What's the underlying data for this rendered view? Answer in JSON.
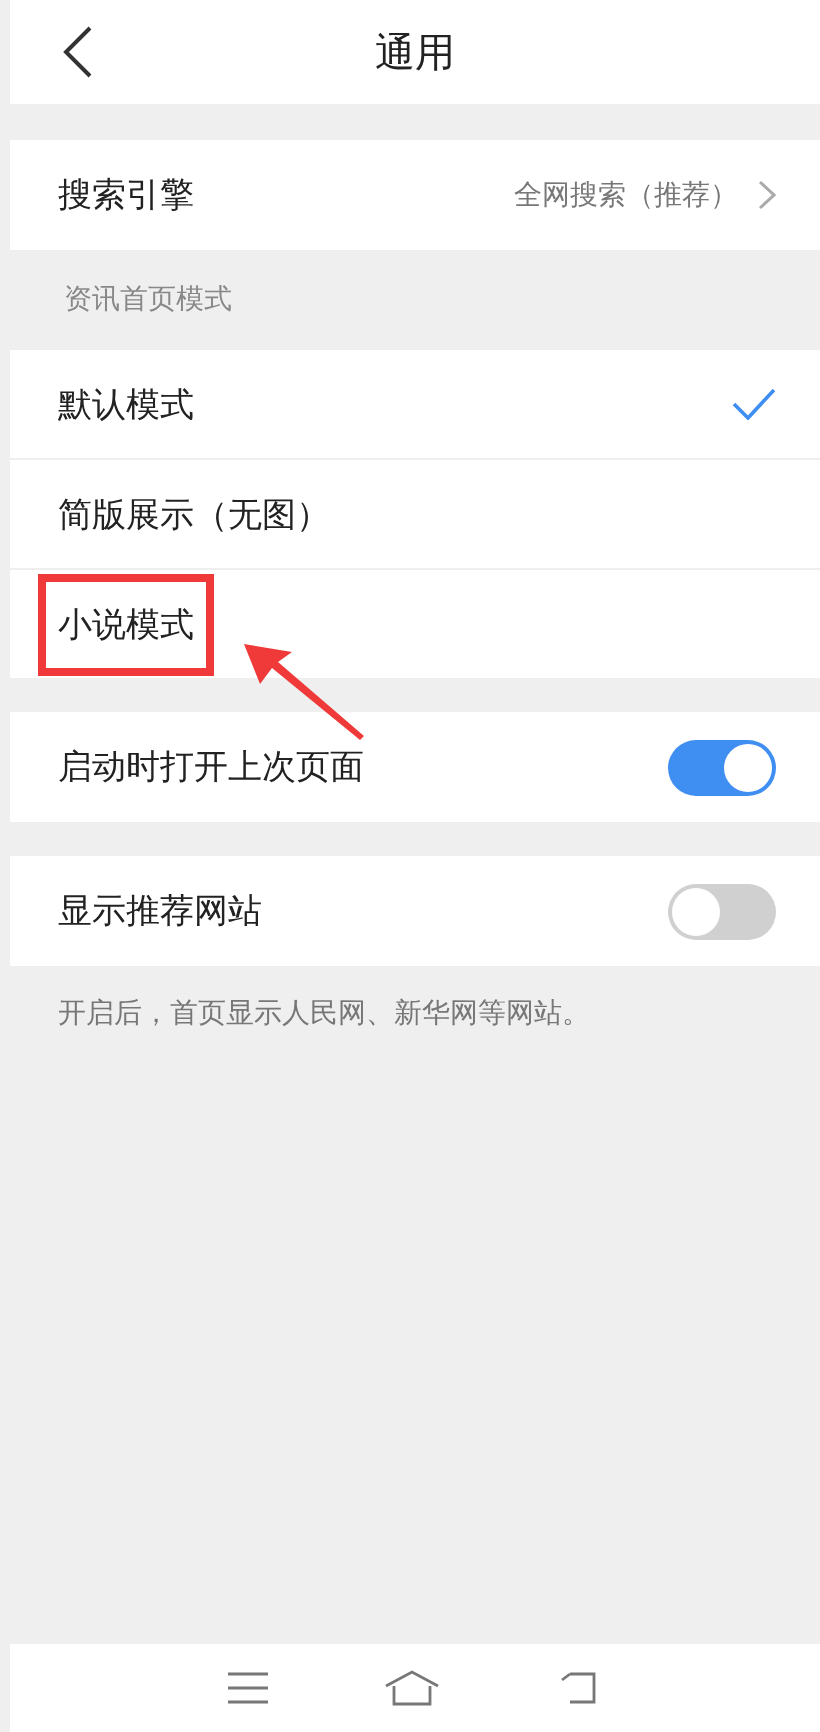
{
  "header": {
    "title": "通用"
  },
  "search_engine": {
    "label": "搜索引擎",
    "value": "全网搜索（推荐）"
  },
  "news_home_mode": {
    "heading": "资讯首页模式",
    "options": [
      {
        "label": "默认模式",
        "selected": true,
        "highlighted": false
      },
      {
        "label": "简版展示（无图）",
        "selected": false,
        "highlighted": false
      },
      {
        "label": "小说模式",
        "selected": false,
        "highlighted": true
      }
    ]
  },
  "toggles": [
    {
      "label": "启动时打开上次页面",
      "on": true
    },
    {
      "label": "显示推荐网站",
      "on": false
    }
  ],
  "toggle_note": "开启后，首页显示人民网、新华网等网站。"
}
